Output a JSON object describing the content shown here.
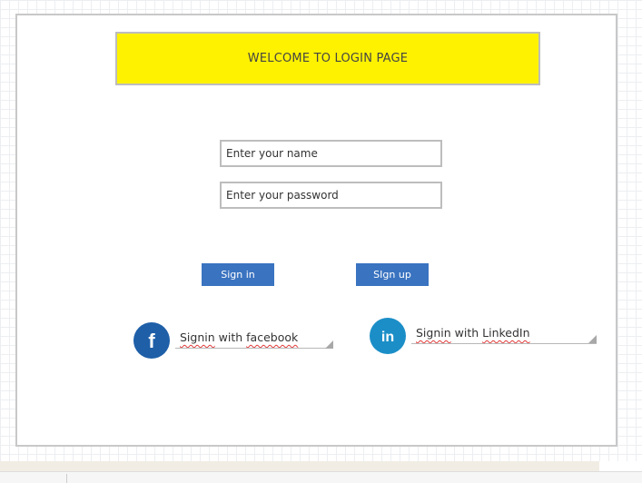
{
  "banner": {
    "title": "WELCOME TO LOGIN PAGE",
    "color": "#fff200"
  },
  "form": {
    "name_placeholder": "Enter your name",
    "password_placeholder": "Enter your password",
    "signin_label": "Sign in",
    "signup_label": "SIgn up",
    "button_color": "#3a73c0"
  },
  "social": {
    "facebook": {
      "prefix": "Signin",
      "middle": " with ",
      "suffix": "facebook",
      "icon": "facebook-icon",
      "glyph": "f",
      "color": "#1e5fa8"
    },
    "linkedin": {
      "prefix": "Signin",
      "middle": " with ",
      "suffix": "LinkedIn",
      "icon": "linkedin-icon",
      "glyph": "in",
      "color": "#1b8ec7"
    }
  }
}
